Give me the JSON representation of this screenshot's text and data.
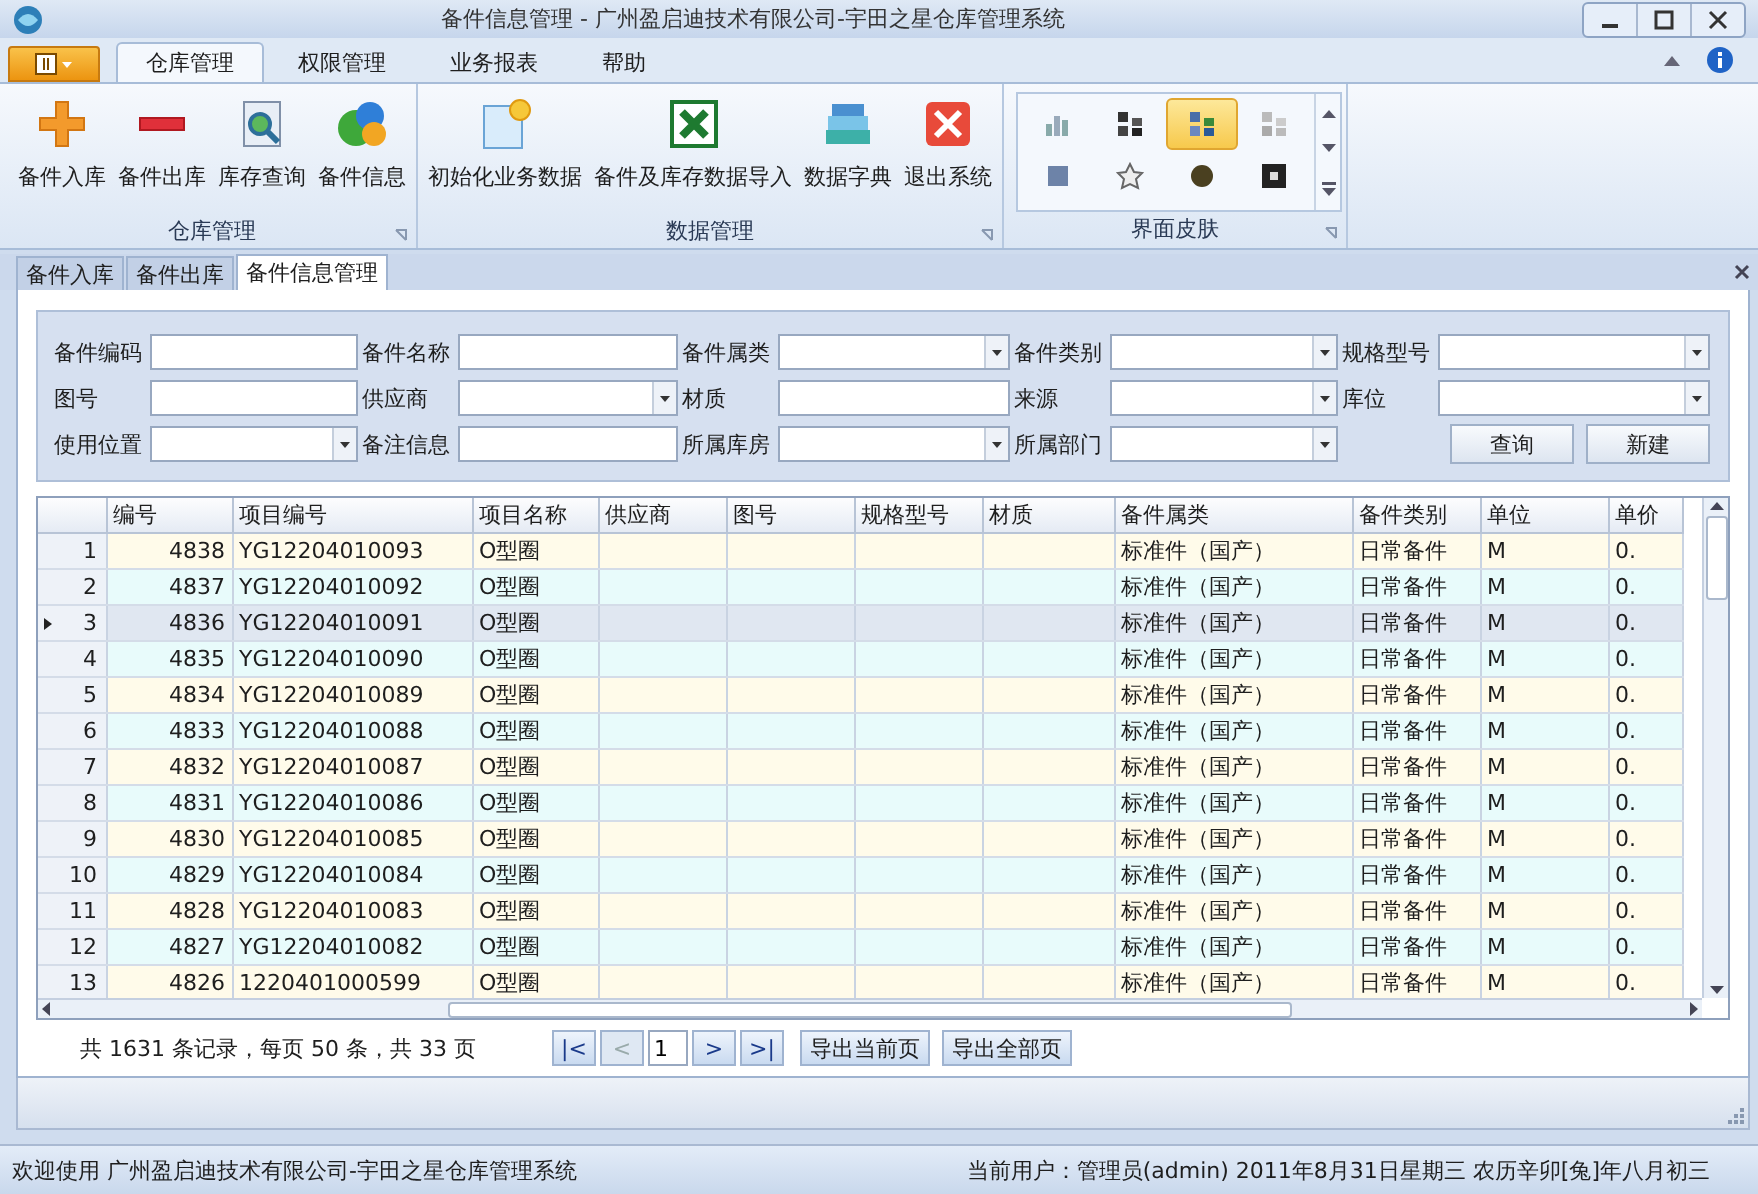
{
  "window": {
    "title": "备件信息管理 - 广州盈启迪技术有限公司-宇田之星仓库管理系统"
  },
  "ribbon": {
    "tabs": [
      {
        "label": "仓库管理",
        "selected": true
      },
      {
        "label": "权限管理",
        "selected": false
      },
      {
        "label": "业务报表",
        "selected": false
      },
      {
        "label": "帮助",
        "selected": false
      }
    ],
    "groups": [
      {
        "label": "仓库管理",
        "buttons": [
          "备件入库",
          "备件出库",
          "库存查询",
          "备件信息"
        ]
      },
      {
        "label": "数据管理",
        "buttons": [
          "初始化业务数据",
          "备件及库存数据导入",
          "数据字典",
          "退出系统"
        ]
      }
    ],
    "skin_group": {
      "label": "界面皮肤",
      "skins": [
        {
          "selected": false
        },
        {
          "selected": false
        },
        {
          "selected": true
        },
        {
          "selected": false
        },
        {
          "selected": false
        },
        {
          "selected": false
        },
        {
          "selected": false
        },
        {
          "selected": false
        }
      ]
    }
  },
  "doc_tabs": [
    {
      "label": "备件入库",
      "selected": false
    },
    {
      "label": "备件出库",
      "selected": false
    },
    {
      "label": "备件信息管理",
      "selected": true
    }
  ],
  "filters": [
    {
      "label": "备件编码",
      "kind": "text"
    },
    {
      "label": "备件名称",
      "kind": "text"
    },
    {
      "label": "备件属类",
      "kind": "combo"
    },
    {
      "label": "备件类别",
      "kind": "combo"
    },
    {
      "label": "规格型号",
      "kind": "combo"
    },
    {
      "label": "图号",
      "kind": "text"
    },
    {
      "label": "供应商",
      "kind": "combo"
    },
    {
      "label": "材质",
      "kind": "text"
    },
    {
      "label": "来源",
      "kind": "combo"
    },
    {
      "label": "库位",
      "kind": "combo"
    },
    {
      "label": "使用位置",
      "kind": "combo"
    },
    {
      "label": "备注信息",
      "kind": "text"
    },
    {
      "label": "所属库房",
      "kind": "combo"
    },
    {
      "label": "所属部门",
      "kind": "combo"
    }
  ],
  "filter_buttons": [
    "查询",
    "新建"
  ],
  "grid": {
    "columns": [
      "编号",
      "项目编号",
      "项目名称",
      "供应商",
      "图号",
      "规格型号",
      "材质",
      "备件属类",
      "备件类别",
      "单位",
      "单价"
    ],
    "rows": [
      {
        "row": "1",
        "id": "4838",
        "code": "YG12204010093",
        "name": "O型圈",
        "category": "标准件（国产）",
        "type": "日常备件",
        "unit": "M",
        "price": "0.",
        "selected": false
      },
      {
        "row": "2",
        "id": "4837",
        "code": "YG12204010092",
        "name": "O型圈",
        "category": "标准件（国产）",
        "type": "日常备件",
        "unit": "M",
        "price": "0.",
        "selected": false
      },
      {
        "row": "3",
        "id": "4836",
        "code": "YG12204010091",
        "name": "O型圈",
        "category": "标准件（国产）",
        "type": "日常备件",
        "unit": "M",
        "price": "0.",
        "selected": true
      },
      {
        "row": "4",
        "id": "4835",
        "code": "YG12204010090",
        "name": "O型圈",
        "category": "标准件（国产）",
        "type": "日常备件",
        "unit": "M",
        "price": "0.",
        "selected": false
      },
      {
        "row": "5",
        "id": "4834",
        "code": "YG12204010089",
        "name": "O型圈",
        "category": "标准件（国产）",
        "type": "日常备件",
        "unit": "M",
        "price": "0.",
        "selected": false
      },
      {
        "row": "6",
        "id": "4833",
        "code": "YG12204010088",
        "name": "O型圈",
        "category": "标准件（国产）",
        "type": "日常备件",
        "unit": "M",
        "price": "0.",
        "selected": false
      },
      {
        "row": "7",
        "id": "4832",
        "code": "YG12204010087",
        "name": "O型圈",
        "category": "标准件（国产）",
        "type": "日常备件",
        "unit": "M",
        "price": "0.",
        "selected": false
      },
      {
        "row": "8",
        "id": "4831",
        "code": "YG12204010086",
        "name": "O型圈",
        "category": "标准件（国产）",
        "type": "日常备件",
        "unit": "M",
        "price": "0.",
        "selected": false
      },
      {
        "row": "9",
        "id": "4830",
        "code": "YG12204010085",
        "name": "O型圈",
        "category": "标准件（国产）",
        "type": "日常备件",
        "unit": "M",
        "price": "0.",
        "selected": false
      },
      {
        "row": "10",
        "id": "4829",
        "code": "YG12204010084",
        "name": "O型圈",
        "category": "标准件（国产）",
        "type": "日常备件",
        "unit": "M",
        "price": "0.",
        "selected": false
      },
      {
        "row": "11",
        "id": "4828",
        "code": "YG12204010083",
        "name": "O型圈",
        "category": "标准件（国产）",
        "type": "日常备件",
        "unit": "M",
        "price": "0.",
        "selected": false
      },
      {
        "row": "12",
        "id": "4827",
        "code": "YG12204010082",
        "name": "O型圈",
        "category": "标准件（国产）",
        "type": "日常备件",
        "unit": "M",
        "price": "0.",
        "selected": false
      },
      {
        "row": "13",
        "id": "4826",
        "code": "1220401000599",
        "name": "O型圈",
        "category": "标准件（国产）",
        "type": "日常备件",
        "unit": "M",
        "price": "0.",
        "selected": false
      }
    ]
  },
  "pager": {
    "summary": "共 1631 条记录，每页 50 条，共 33 页",
    "nav": [
      {
        "label": "|<",
        "disabled": false
      },
      {
        "label": "<",
        "disabled": true
      },
      {
        "label": ">",
        "disabled": false
      },
      {
        "label": ">|",
        "disabled": false
      }
    ],
    "page": "1",
    "exports": [
      "导出当前页",
      "导出全部页"
    ]
  },
  "status_bar": {
    "left": "欢迎使用 广州盈启迪技术有限公司-宇田之星仓库管理系统",
    "right": "当前用户：管理员(admin)  2011年8月31日星期三 农历辛卯[兔]年八月初三"
  }
}
